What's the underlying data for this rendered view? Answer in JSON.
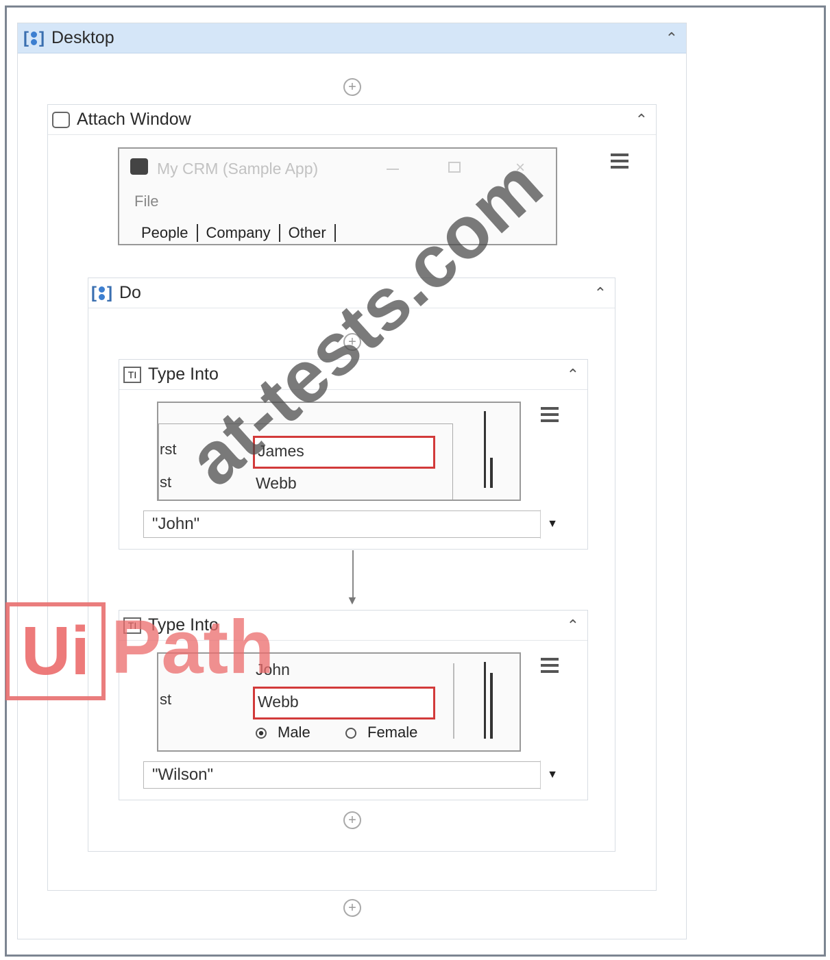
{
  "desktop": {
    "title": "Desktop"
  },
  "attach_window": {
    "title": "Attach Window",
    "app": {
      "title": "My CRM (Sample App)",
      "menu_file": "File",
      "tabs": [
        "People",
        "Company",
        "Other"
      ]
    }
  },
  "do": {
    "title": "Do"
  },
  "type_into_1": {
    "title": "Type Into",
    "labels": {
      "first": "rst",
      "last": "st"
    },
    "first_value": "James",
    "last_value": "Webb",
    "text_value": "\"John\""
  },
  "type_into_2": {
    "title": "Type Into",
    "labels": {
      "last": "st"
    },
    "first_value": "John",
    "last_value": "Webb",
    "radio_male": "Male",
    "radio_female": "Female",
    "text_value": "\"Wilson\""
  },
  "watermark": {
    "logo_ui": "Ui",
    "logo_path": "Path",
    "site": "at-tests.com"
  }
}
